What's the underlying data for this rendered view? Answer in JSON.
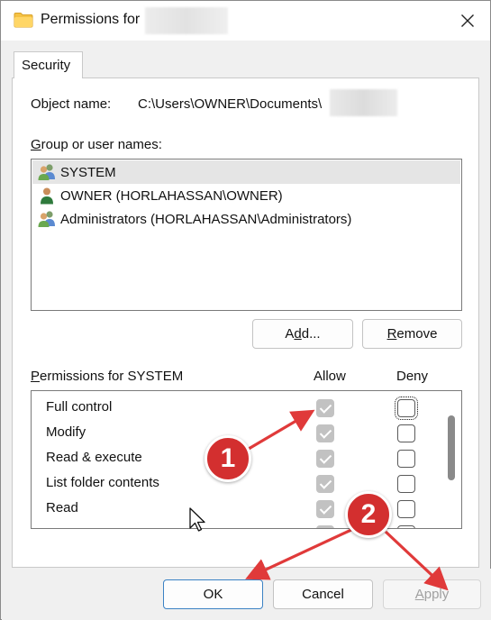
{
  "window": {
    "title": "Permissions for",
    "close_glyph": "✕"
  },
  "tabs": [
    {
      "label": "Security"
    }
  ],
  "object": {
    "label": "Object name:",
    "value": "C:\\Users\\OWNER\\Documents\\"
  },
  "group": {
    "label_underlined": "G",
    "label_rest": "roup or user names:",
    "users": [
      {
        "name": "SYSTEM",
        "icon": "group-users-icon",
        "selected": true
      },
      {
        "name": "OWNER (HORLAHASSAN\\OWNER)",
        "icon": "user-icon",
        "selected": false
      },
      {
        "name": "Administrators (HORLAHASSAN\\Administrators)",
        "icon": "group-users-icon",
        "selected": false
      }
    ]
  },
  "buttons": {
    "add_pre": "A",
    "add_ul": "d",
    "add_post": "d...",
    "remove_ul": "R",
    "remove_rest": "emove",
    "ok": "OK",
    "cancel": "Cancel",
    "apply_ul": "A",
    "apply_rest": "pply"
  },
  "permissions": {
    "label_ul": "P",
    "label_rest": "ermissions for SYSTEM",
    "allow_header": "Allow",
    "deny_header": "Deny",
    "rows": [
      {
        "name": "Full control",
        "allow": true,
        "deny": false
      },
      {
        "name": "Modify",
        "allow": true,
        "deny": false
      },
      {
        "name": "Read & execute",
        "allow": true,
        "deny": false
      },
      {
        "name": "List folder contents",
        "allow": true,
        "deny": false
      },
      {
        "name": "Read",
        "allow": true,
        "deny": false
      }
    ]
  },
  "annotations": {
    "badge1": "1",
    "badge2": "2",
    "arrow_color": "#e03a3a",
    "badge_color": "#d32f2f"
  }
}
